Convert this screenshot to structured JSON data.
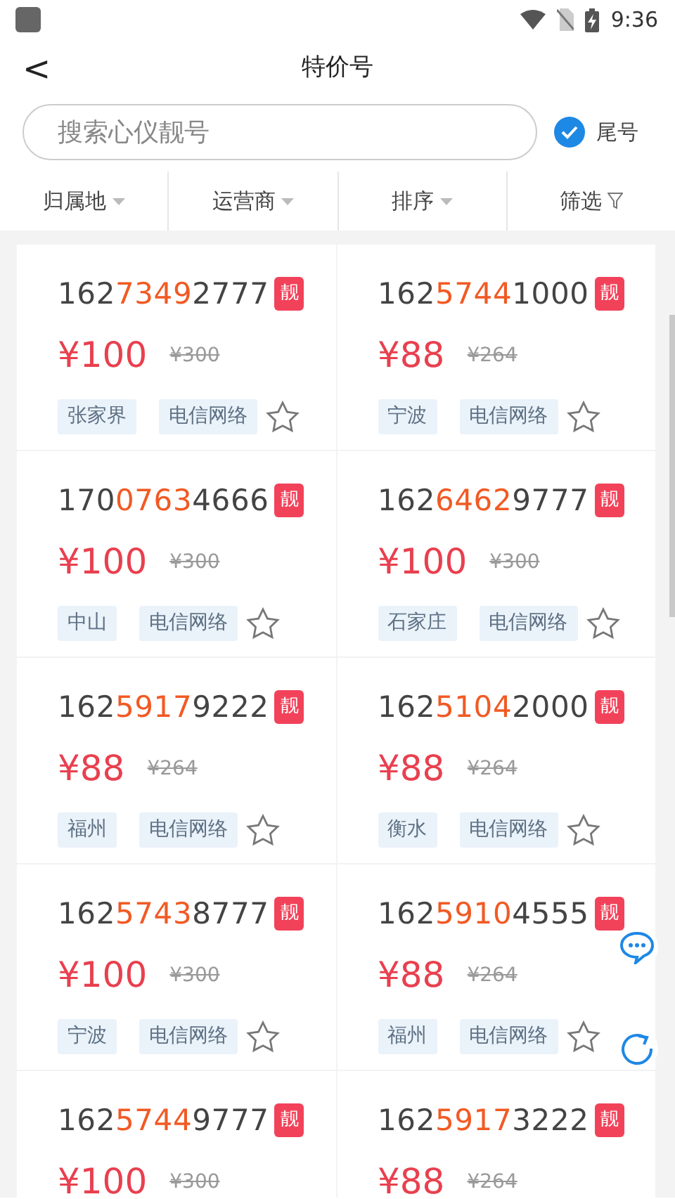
{
  "status_bar": {
    "time": "9:36"
  },
  "header": {
    "back": "<",
    "title": "特价号"
  },
  "search": {
    "placeholder": "搜索心仪靓号",
    "tail_option": {
      "label": "尾号",
      "checked": true
    }
  },
  "filters": [
    {
      "label": "归属地",
      "kind": "dropdown"
    },
    {
      "label": "运营商",
      "kind": "dropdown"
    },
    {
      "label": "排序",
      "kind": "dropdown"
    },
    {
      "label": "筛选",
      "kind": "filter"
    }
  ],
  "numbers": [
    {
      "prefix": "162",
      "highlight": "7349",
      "suffix": "2777",
      "badge": "靓",
      "price": "¥100",
      "original_price": "¥300",
      "tags": [
        "张家界",
        "电信网络"
      ],
      "starred": false
    },
    {
      "prefix": "162",
      "highlight": "5744",
      "suffix": "1000",
      "badge": "靓",
      "price": "¥88",
      "original_price": "¥264",
      "tags": [
        "宁波",
        "电信网络"
      ],
      "starred": false
    },
    {
      "prefix": "170",
      "highlight": "0763",
      "suffix": "4666",
      "badge": "靓",
      "price": "¥100",
      "original_price": "¥300",
      "tags": [
        "中山",
        "电信网络"
      ],
      "starred": false
    },
    {
      "prefix": "162",
      "highlight": "6462",
      "suffix": "9777",
      "badge": "靓",
      "price": "¥100",
      "original_price": "¥300",
      "tags": [
        "石家庄",
        "电信网络"
      ],
      "starred": false
    },
    {
      "prefix": "162",
      "highlight": "5917",
      "suffix": "9222",
      "badge": "靓",
      "price": "¥88",
      "original_price": "¥264",
      "tags": [
        "福州",
        "电信网络"
      ],
      "starred": false
    },
    {
      "prefix": "162",
      "highlight": "5104",
      "suffix": "2000",
      "badge": "靓",
      "price": "¥88",
      "original_price": "¥264",
      "tags": [
        "衡水",
        "电信网络"
      ],
      "starred": false
    },
    {
      "prefix": "162",
      "highlight": "5743",
      "suffix": "8777",
      "badge": "靓",
      "price": "¥100",
      "original_price": "¥300",
      "tags": [
        "宁波",
        "电信网络"
      ],
      "starred": false
    },
    {
      "prefix": "162",
      "highlight": "5910",
      "suffix": "4555",
      "badge": "靓",
      "price": "¥88",
      "original_price": "¥264",
      "tags": [
        "福州",
        "电信网络"
      ],
      "starred": false
    },
    {
      "prefix": "162",
      "highlight": "5744",
      "suffix": "9777",
      "badge": "靓",
      "price": "¥100",
      "original_price": "¥300"
    },
    {
      "prefix": "162",
      "highlight": "5917",
      "suffix": "3222",
      "badge": "靓",
      "price": "¥88",
      "original_price": "¥264"
    }
  ]
}
